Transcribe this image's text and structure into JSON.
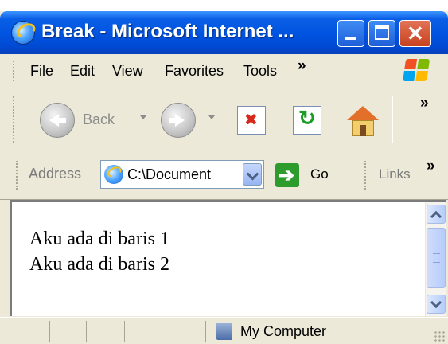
{
  "window": {
    "title": "Break - Microsoft Internet ...",
    "controls": {
      "minimize": "minimize",
      "maximize": "maximize",
      "close": "✕"
    }
  },
  "menubar": {
    "items": [
      "File",
      "Edit",
      "View",
      "Favorites",
      "Tools"
    ],
    "overflow": "»"
  },
  "toolbar": {
    "back_label": "Back",
    "overflow": "»",
    "icons": [
      "back-icon",
      "forward-icon",
      "stop-icon",
      "refresh-icon",
      "home-icon"
    ]
  },
  "address": {
    "label": "Address",
    "value": "C:\\Document",
    "go_label": "Go",
    "links_label": "Links",
    "overflow": "»"
  },
  "content": {
    "lines": [
      "Aku ada di baris 1",
      "Aku ada di baris 2"
    ]
  },
  "status": {
    "zone": "My Computer"
  },
  "colors": {
    "titlebar": "#0053e0",
    "close_button": "#c7421e",
    "chrome": "#ece9d8"
  }
}
